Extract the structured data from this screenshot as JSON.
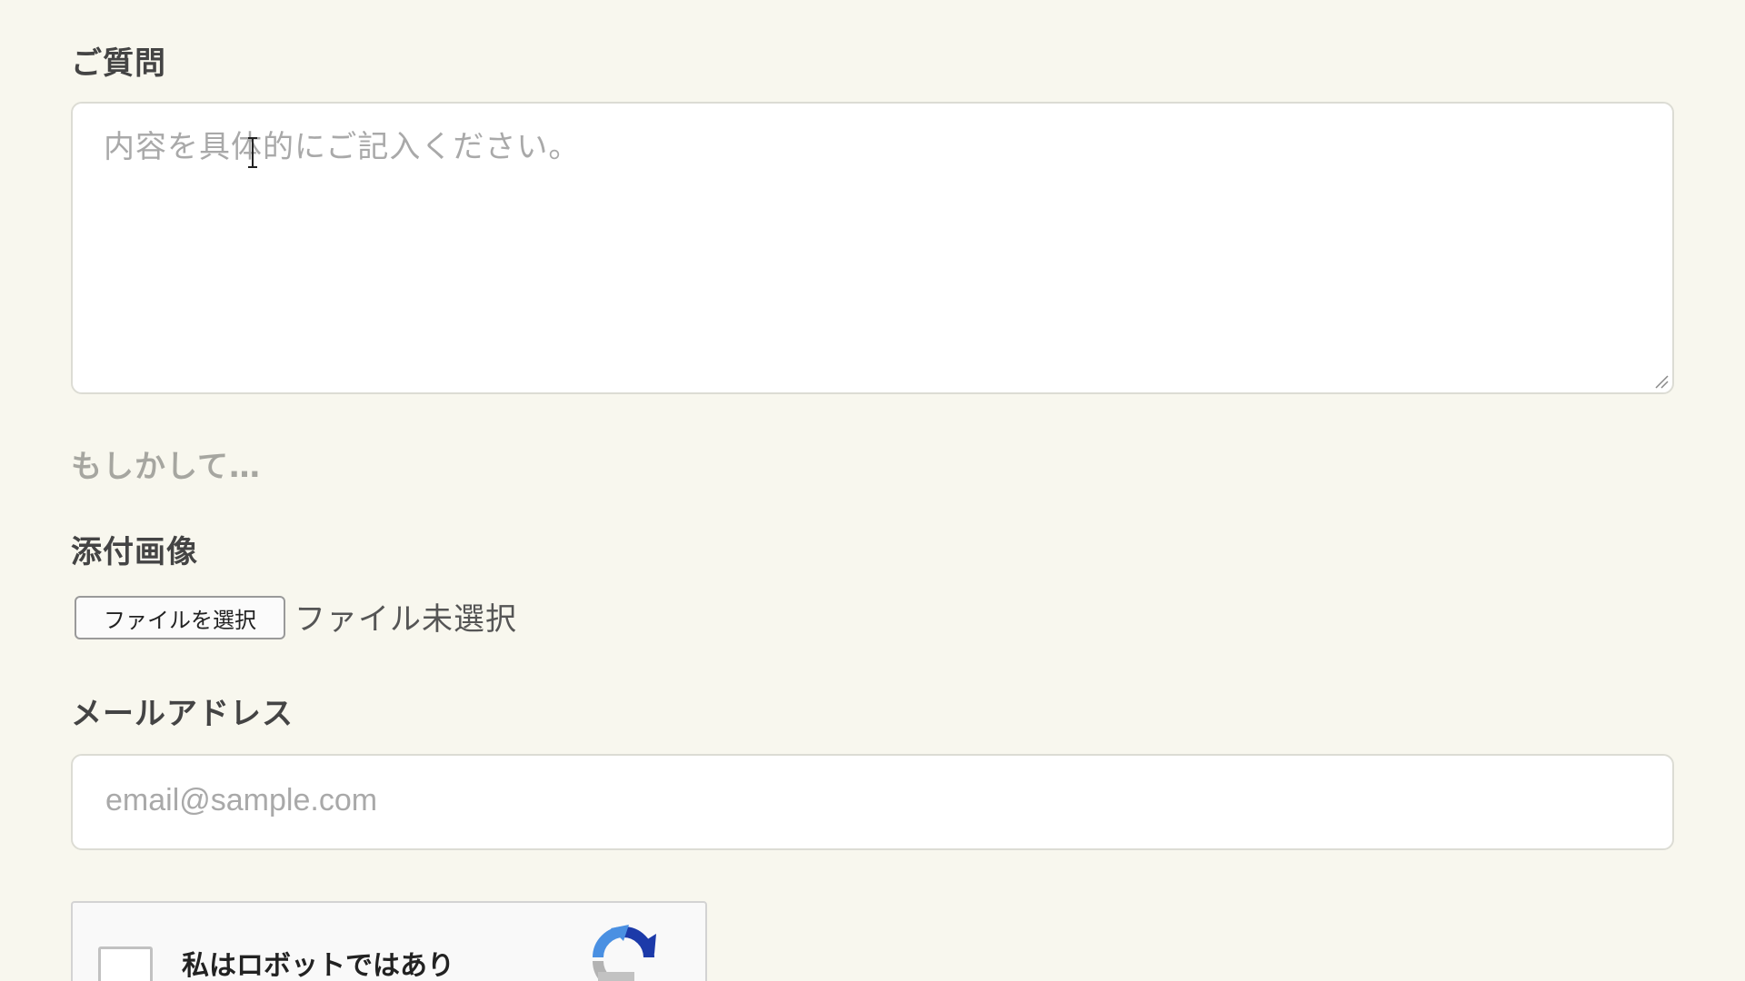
{
  "question": {
    "label": "ご質問",
    "placeholder": "内容を具体的にご記入ください。"
  },
  "suggest": {
    "text": "もしかして…"
  },
  "attachment": {
    "label": "添付画像",
    "button_label": "ファイルを選択",
    "status": "ファイル未選択"
  },
  "email": {
    "label": "メールアドレス",
    "placeholder": "email@sample.com"
  },
  "recaptcha": {
    "label": "私はロボットではあり",
    "logo_icon": "recaptcha-icon"
  },
  "colors": {
    "background": "#f8f7ee",
    "placeholder": "#a9a9a9",
    "recaptcha_blue": "#1c3aa9",
    "recaptcha_light_blue": "#4a90e2"
  }
}
